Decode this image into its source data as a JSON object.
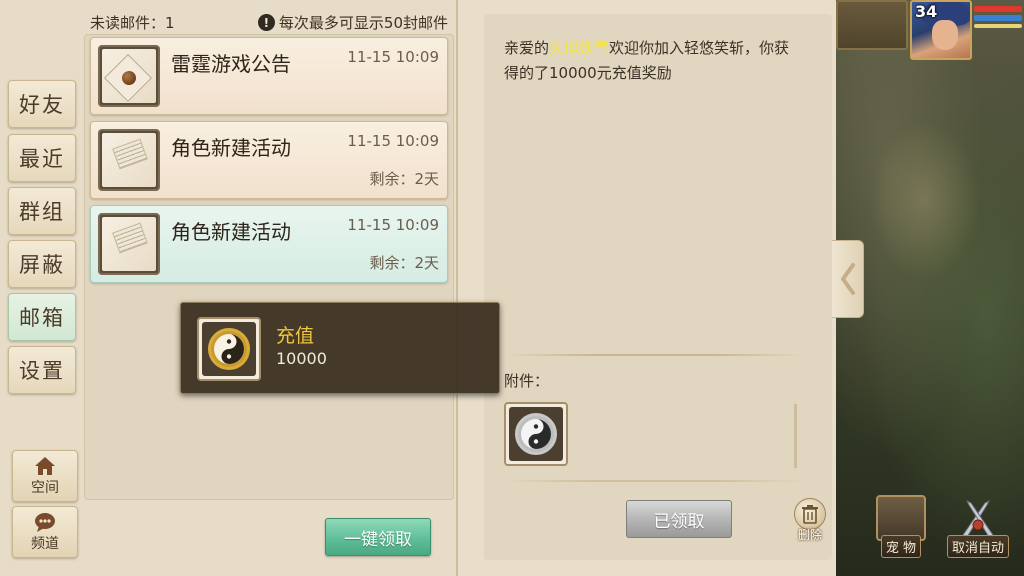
{
  "header": {
    "unread_label": "未读邮件：1",
    "limit_note": "每次最多可显示50封邮件",
    "warn_icon": "!"
  },
  "side_nav": {
    "items": [
      {
        "label": "好友",
        "active": false
      },
      {
        "label": "最近",
        "active": false
      },
      {
        "label": "群组",
        "active": false
      },
      {
        "label": "屏蔽",
        "active": false
      },
      {
        "label": "邮箱",
        "active": true
      },
      {
        "label": "设置",
        "active": false
      }
    ],
    "space_label": "空间",
    "channel_label": "频道"
  },
  "mails": [
    {
      "title": "雷霆游戏公告",
      "time": "11-15 10:09",
      "remaining": "",
      "icon": "sealed-envelope-icon",
      "selected": false
    },
    {
      "title": "角色新建活动",
      "time": "11-15 10:09",
      "remaining": "剩余：2天",
      "icon": "open-envelope-icon",
      "selected": false
    },
    {
      "title": "角色新建活动",
      "time": "11-15 10:09",
      "remaining": "剩余：2天",
      "icon": "open-envelope-icon",
      "selected": true
    }
  ],
  "tooltip": {
    "item_name": "充值",
    "amount": "10000",
    "icon": "taiji-gold-icon"
  },
  "claim_all_label": "一键领取",
  "detail": {
    "greeting_prefix": "亲爱的",
    "player_name": "久似妖气",
    "message_rest": "欢迎你加入轻悠笑斩，你获得的了10000元充值奖励",
    "attachment_label": "附件：",
    "attachment_icon": "taiji-silver-icon",
    "claimed_label": "已领取",
    "delete_label": "删除"
  },
  "hud": {
    "player_level": "34",
    "pet_label": "宠 物",
    "cancel_auto_label": "取消自动",
    "colors": {
      "hp": "#e0392b",
      "mp": "#3b7fd1",
      "accent_green": "#5fbf98",
      "highlight_name": "#f3e43a",
      "gold_text": "#f2c63c"
    }
  }
}
